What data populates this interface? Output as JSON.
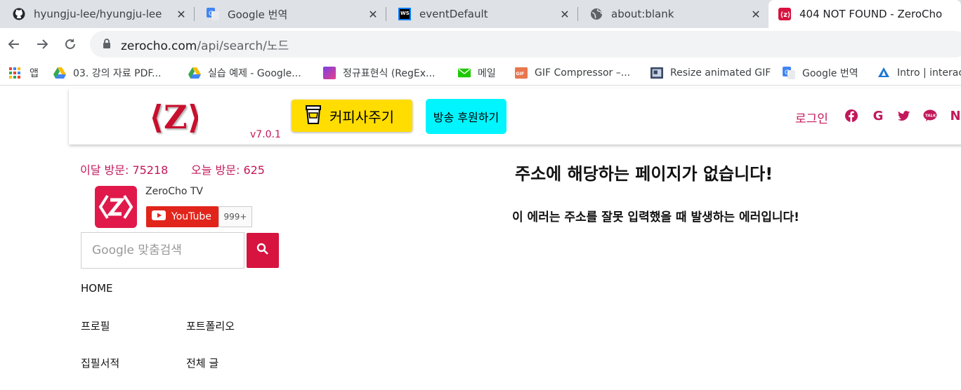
{
  "browser": {
    "tabs": [
      {
        "title": "hyungju-lee/hyungju-lee",
        "icon": "github-icon"
      },
      {
        "title": "Google 번역",
        "icon": "google-translate-icon"
      },
      {
        "title": "eventDefault",
        "icon": "webstorm-icon"
      },
      {
        "title": "about:blank",
        "icon": "globe-icon"
      },
      {
        "title": "404 NOT FOUND - ZeroCho",
        "icon": "zerocho-icon"
      }
    ],
    "close_glyph": "✕",
    "address": {
      "host": "zerocho.com",
      "path": "/api/search/노드"
    },
    "bookmarks": [
      {
        "label": "앱",
        "icon": "apps-grid-icon"
      },
      {
        "label": "03. 강의 자료 PDF...",
        "icon": "google-drive-icon"
      },
      {
        "label": "실습 예제 - Google...",
        "icon": "google-drive-icon"
      },
      {
        "label": "정규표현식 (RegEx...",
        "icon": "gradient-square-icon"
      },
      {
        "label": "메일",
        "icon": "mail-icon"
      },
      {
        "label": "GIF Compressor –...",
        "icon": "gif-icon"
      },
      {
        "label": "Resize animated GIF",
        "icon": "resize-gif-icon"
      },
      {
        "label": "Google 번역",
        "icon": "google-translate-icon"
      },
      {
        "label": "Intro | interac",
        "icon": "angular-icon"
      }
    ]
  },
  "header": {
    "version": "v7.0.1",
    "coffee_label": "커피사주기",
    "donate_label": "방송 후원하기",
    "login_label": "로그인",
    "social_icons": [
      "facebook-icon",
      "google-icon",
      "twitter-icon",
      "kakaotalk-icon",
      "naver-icon"
    ],
    "kakao_text": "TALK",
    "naver_text": "N",
    "google_text": "G"
  },
  "sidebar": {
    "month_visits": "이달 방문: 75218",
    "today_visits": "오늘 방문: 625",
    "channel_name": "ZeroCho TV",
    "youtube_label": "YouTube",
    "youtube_count": "999+",
    "search_placeholder": "Google 맞춤검색",
    "nav": {
      "home": "HOME",
      "profile": "프로필",
      "portfolio": "포트폴리오",
      "writing": "집필서적",
      "all_posts": "전체 글"
    }
  },
  "main": {
    "error_title": "주소에 해당하는 페이지가 없습니다!",
    "error_description": "이 에러는 주소를 잘못 입력했을 때 발생하는 에러입니다!"
  },
  "colors": {
    "brand": "#c2185b",
    "coffee": "#ffdd00",
    "donate": "#00f5ff",
    "search_button": "#d7133f",
    "youtube": "#e1251b"
  }
}
